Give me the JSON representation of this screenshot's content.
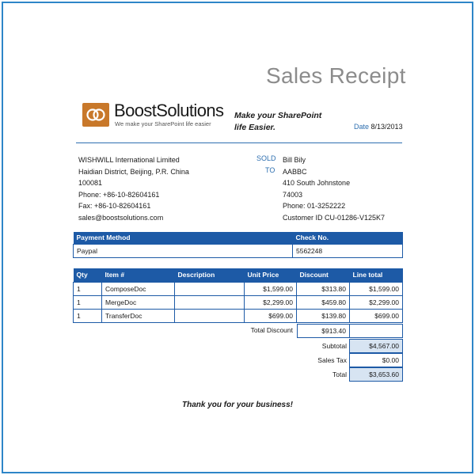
{
  "receipt": {
    "title": "Sales Receipt",
    "date_label": "Date",
    "date": "8/13/2013",
    "thanks": "Thank you for your business!"
  },
  "company": {
    "logo_name_bold": "Boost",
    "logo_name_rest": "Solutions",
    "logo_tagline": "We make your SharePoint life easier",
    "slogan_line1": "Make your SharePoint",
    "slogan_line2": "life Easier.",
    "lines": [
      "WISHWILL International Limited",
      "Haidian District, Beijing, P.R. China",
      "100081",
      "Phone: +86-10-82604161",
      "Fax: +86-10-82604161",
      "sales@boostsolutions.com"
    ]
  },
  "sold_to": {
    "label_sold": "SOLD",
    "label_to": "TO",
    "lines": [
      "Bill Bily",
      "AABBC",
      "410 South Johnstone",
      "74003",
      "Phone: 01-3252222",
      "Customer ID CU-01286-V125K7"
    ]
  },
  "payment": {
    "headers": [
      "Payment Method",
      "Check No."
    ],
    "row": [
      "Paypal",
      "5562248"
    ]
  },
  "items": {
    "headers": [
      "Qty",
      "Item #",
      "Description",
      "Unit Price",
      "Discount",
      "Line total"
    ],
    "rows": [
      [
        "1",
        "ComposeDoc",
        "",
        "$1,599.00",
        "$313.80",
        "$1,599.00"
      ],
      [
        "1",
        "MergeDoc",
        "",
        "$2,299.00",
        "$459.80",
        "$2,299.00"
      ],
      [
        "1",
        "TransferDoc",
        "",
        "$699.00",
        "$139.80",
        "$699.00"
      ]
    ]
  },
  "totals": {
    "total_discount_label": "Total Discount",
    "total_discount": "$913.40",
    "subtotal_label": "Subtotal",
    "subtotal": "$4,567.00",
    "sales_tax_label": "Sales Tax",
    "sales_tax": "$0.00",
    "total_label": "Total",
    "total": "$3,653.60"
  },
  "colors": {
    "accent": "#1d5aa6",
    "frame": "#2e86c8",
    "logo": "#c8782a",
    "shade": "#d7e4f2"
  }
}
